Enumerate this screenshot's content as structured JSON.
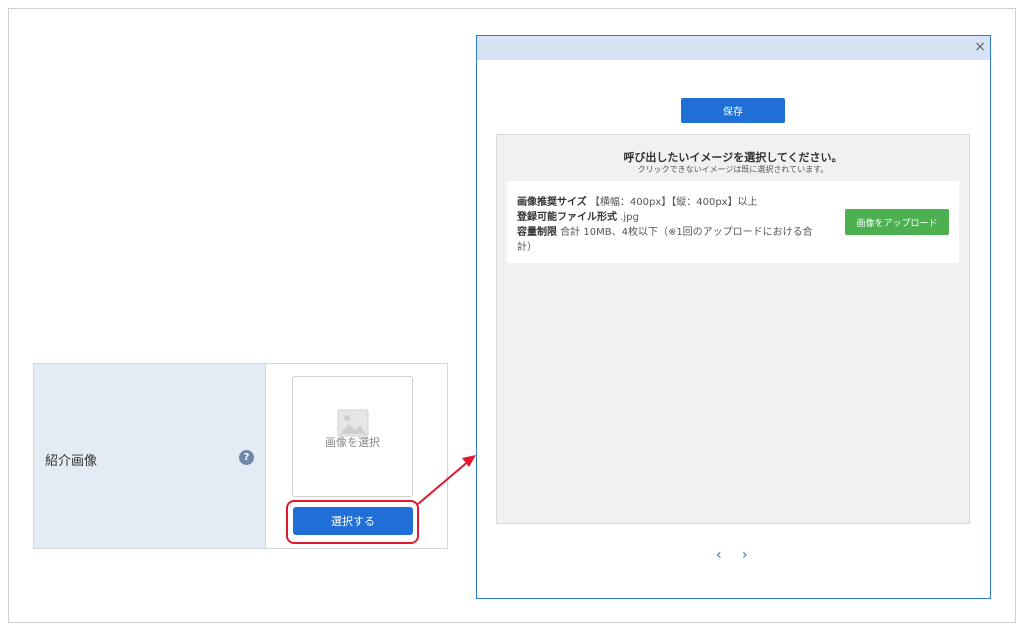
{
  "form": {
    "field_label": "紹介画像",
    "help_icon_glyph": "?",
    "image_placeholder": "画像を選択",
    "select_button": "選択する"
  },
  "modal": {
    "close_glyph": "×",
    "save_button": "保存",
    "title": "呼び出したいイメージを選択してください。",
    "subtitle": "クリックできないイメージは既に選択されています。",
    "info": {
      "size_label": "画像推奨サイズ",
      "size_value": "【横幅：400px】【縦：400px】以上",
      "format_label": "登録可能ファイル形式",
      "format_value": ".jpg",
      "limit_label": "容量制限",
      "limit_value_line1": "合計 10MB、4枚以下（※1回のアップロードにおける合",
      "limit_value_line2": "計）"
    },
    "upload_button": "画像をアップロード",
    "prev_glyph": "‹",
    "next_glyph": "›"
  },
  "colors": {
    "primary": "#1f6fd6",
    "upload": "#4caf50",
    "highlight": "#e0192e",
    "label_bg": "#e3ebf4"
  },
  "icons": {
    "help": "help-icon",
    "placeholder": "image-placeholder-icon",
    "close": "close-icon",
    "prev": "chevron-left-icon",
    "next": "chevron-right-icon",
    "arrow": "arrow-annotation"
  }
}
